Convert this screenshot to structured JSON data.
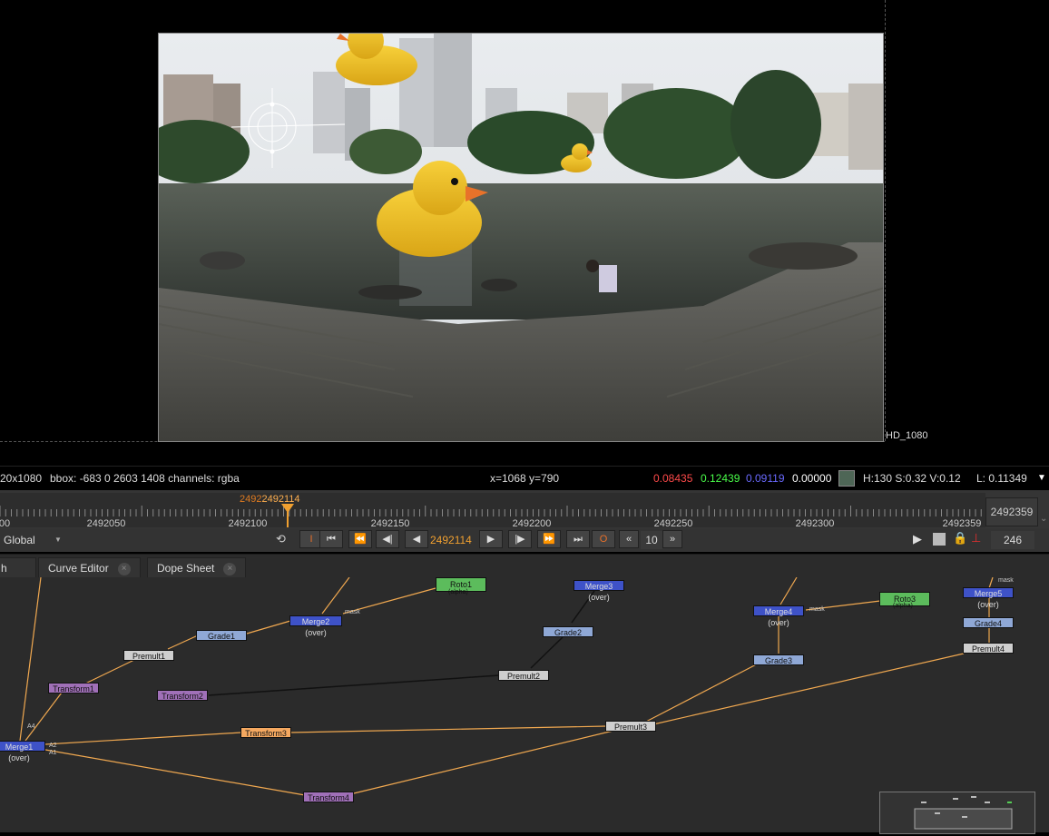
{
  "viewer": {
    "format_label": "HD_1080"
  },
  "infobar": {
    "format": "20x1080",
    "bbox": "bbox: -683 0 2603 1408 channels: rgba",
    "coords": "x=1068 y=790",
    "r": "0.08435",
    "g": "0.12439",
    "b": "0.09119",
    "a": "0.00000",
    "sample_color": "#4e6656",
    "hsv": "H:130 S:0.32 V:0.12",
    "lum": "L: 0.11349",
    "colors": {
      "r": "#ff4040",
      "g": "#40ff40",
      "b": "#5a5aff",
      "a": "#ffffff"
    }
  },
  "timeline": {
    "current_frame_overlay": "2492114",
    "current_frame_left": "2492",
    "ticks": [
      "00",
      "2492050",
      "2492100",
      "2492150",
      "2492200",
      "2492250",
      "2492300",
      "2492359"
    ],
    "end_frame": "2492359"
  },
  "transport": {
    "scope": "Global",
    "frame": "2492114",
    "step": "10",
    "fps": "246",
    "in_label": "I",
    "out_label": "O"
  },
  "tabs": [
    {
      "label": "h"
    },
    {
      "label": "Curve Editor"
    },
    {
      "label": "Dope Sheet"
    }
  ],
  "nodes": {
    "roto1": "Roto1",
    "roto1_sub": "(alpha)",
    "merge3": "Merge3 (over)",
    "merge2": "Merge2 (over)",
    "mask1": "mask",
    "grade1": "Grade1",
    "grade2": "Grade2",
    "premult1": "Premult1",
    "premult2": "Premult2",
    "transform1": "Transform1",
    "transform2": "Transform2",
    "transform3": "Transform3",
    "transform4": "Transform4",
    "merge1": "Merge1 (over)",
    "merge4": "Merge4 (over)",
    "mask2": "mask",
    "roto3": "Roto3",
    "roto3_sub": "(alpha)",
    "grade3": "Grade3",
    "merge5": "Merge5 (over)",
    "mask3": "mask",
    "grade4": "Grade4",
    "premult4": "Premult4",
    "premult3": "Premult3",
    "pin_a4": "A4",
    "pin_a2": "A2",
    "pin_a1": "A1"
  }
}
